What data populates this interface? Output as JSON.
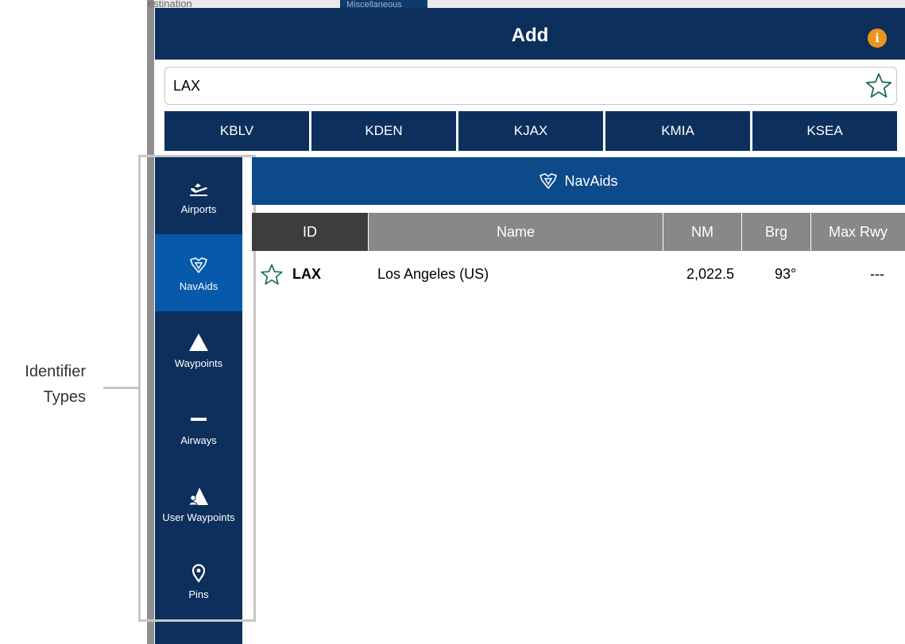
{
  "background": {
    "peek_text": "estination",
    "peek_tab": "Miscellaneous"
  },
  "header": {
    "title": "Add",
    "info_icon": "i"
  },
  "search": {
    "value": "LAX",
    "placeholder": ""
  },
  "recent": [
    "KBLV",
    "KDEN",
    "KJAX",
    "KMIA",
    "KSEA"
  ],
  "sidebar": {
    "items": [
      {
        "label": "Airports",
        "icon": "airplane-departure-icon"
      },
      {
        "label": "NavAids",
        "icon": "vortac-icon"
      },
      {
        "label": "Waypoints",
        "icon": "triangle-icon"
      },
      {
        "label": "Airways",
        "icon": "airway-icon"
      },
      {
        "label": "User Waypoints",
        "icon": "user-waypoint-icon"
      },
      {
        "label": "Pins",
        "icon": "pin-icon"
      }
    ],
    "active": "NavAids"
  },
  "annotation": {
    "line1": "Identifier",
    "line2": "Types"
  },
  "section": {
    "title": "NavAids"
  },
  "table": {
    "columns": [
      "ID",
      "Name",
      "NM",
      "Brg",
      "Max Rwy"
    ],
    "rows": [
      {
        "id": "LAX",
        "name": "Los Angeles (US)",
        "nm": "2,022.5",
        "brg": "93°",
        "max_rwy": "---"
      }
    ]
  },
  "colors": {
    "header": "#0d2f5c",
    "active": "#0659ab",
    "section": "#0d4a8a",
    "info": "#f0931e",
    "star": "#1d6b54"
  }
}
